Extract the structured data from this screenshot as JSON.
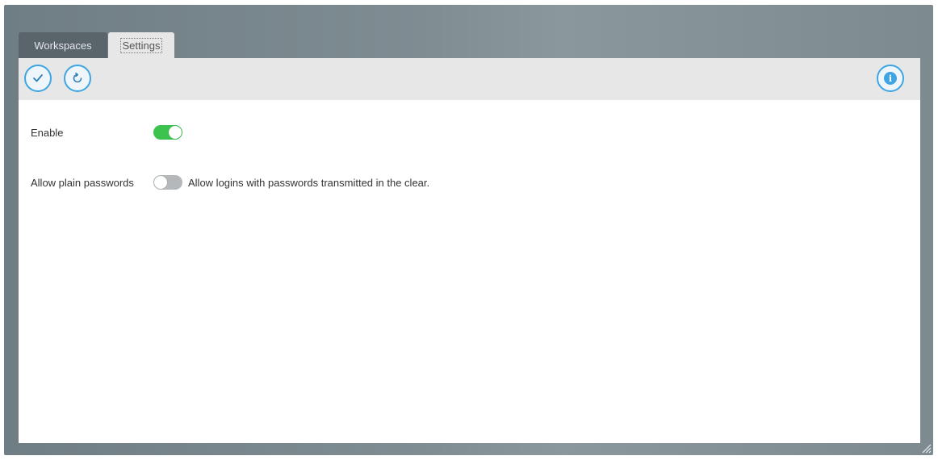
{
  "tabs": [
    {
      "label": "Workspaces",
      "active": false
    },
    {
      "label": "Settings",
      "active": true
    }
  ],
  "toolbar": {
    "apply_icon": "check-icon",
    "refresh_icon": "refresh-icon",
    "info_icon": "info-icon",
    "accent_color": "#3ea4e2"
  },
  "settings": {
    "enable": {
      "label": "Enable",
      "state": "on"
    },
    "allow_plain_passwords": {
      "label": "Allow plain passwords",
      "state": "off",
      "description": "Allow logins with passwords transmitted in the clear."
    }
  },
  "colors": {
    "toggle_on": "#3cc34e",
    "toggle_off": "#b5b8ba",
    "tab_inactive": "#5a646b",
    "toolbar_bg": "#e7e7e7"
  }
}
